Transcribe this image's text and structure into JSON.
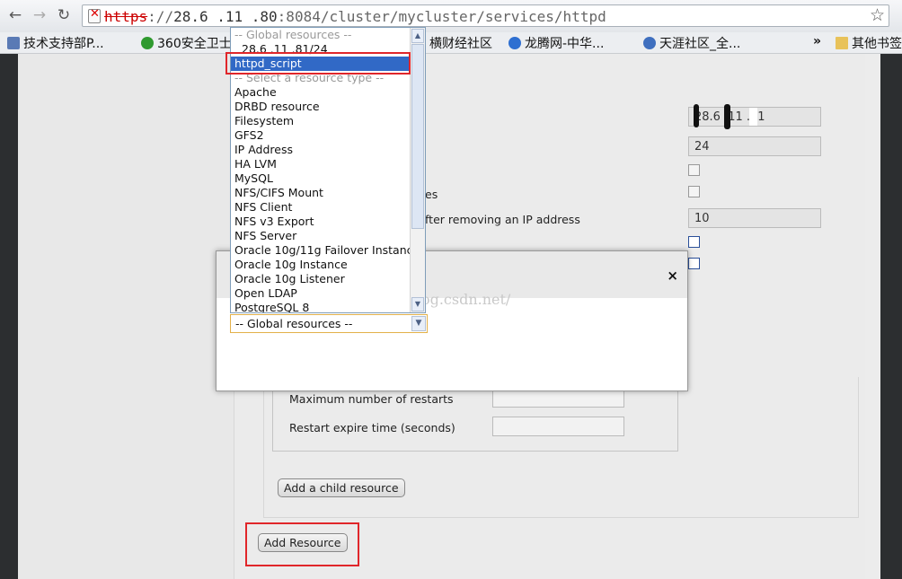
{
  "browser": {
    "nav": {
      "back": "←",
      "forward": "→",
      "reload": "↻",
      "star": "☆"
    },
    "url": {
      "scheme": "https",
      "sep": "://",
      "host": "28.6 .11 .80",
      "rest": ":8084/cluster/mycluster/services/httpd"
    },
    "bookmarks": [
      {
        "label": "技术支持部P...",
        "color": "#5a7ab5"
      },
      {
        "label": "360安全卫士",
        "color": "#2f9a2f"
      },
      {
        "label": "横财经社区",
        "color": "#c04a2a"
      },
      {
        "label": "龙腾网-中华...",
        "color": "#2e6fd1"
      },
      {
        "label": "天涯社区_全...",
        "color": "#3f6fbf"
      }
    ],
    "more": "»",
    "other_bookmarks": "其他书签"
  },
  "form": {
    "ip_value": "28.6 .11 .81",
    "netmask_value": "24",
    "label_es": "es",
    "label_after_remove": "fter removing an IP address",
    "sleep_value": "10",
    "max_restarts_label": "Maximum number of restarts",
    "restart_expire_label": "Restart expire time (seconds)",
    "add_child_button": "Add a child resource",
    "add_resource_button": "Add Resource"
  },
  "modal": {
    "close": "×",
    "watermark": "http://blog.csdn.net/"
  },
  "dropdown": {
    "options": [
      {
        "label": "-- Global resources --",
        "kind": "group"
      },
      {
        "label": "28.6 .11 .81/24",
        "kind": "item"
      },
      {
        "label": "httpd_script",
        "kind": "selected"
      },
      {
        "label": "-- Select a resource type --",
        "kind": "group"
      },
      {
        "label": "Apache",
        "kind": "item"
      },
      {
        "label": "DRBD resource",
        "kind": "item"
      },
      {
        "label": "Filesystem",
        "kind": "item"
      },
      {
        "label": "GFS2",
        "kind": "item"
      },
      {
        "label": "IP Address",
        "kind": "item"
      },
      {
        "label": "HA LVM",
        "kind": "item"
      },
      {
        "label": "MySQL",
        "kind": "item"
      },
      {
        "label": "NFS/CIFS Mount",
        "kind": "item"
      },
      {
        "label": "NFS Client",
        "kind": "item"
      },
      {
        "label": "NFS v3 Export",
        "kind": "item"
      },
      {
        "label": "NFS Server",
        "kind": "item"
      },
      {
        "label": "Oracle 10g/11g Failover Instance",
        "kind": "item"
      },
      {
        "label": "Oracle 10g Instance",
        "kind": "item"
      },
      {
        "label": "Oracle 10g Listener",
        "kind": "item"
      },
      {
        "label": "Open LDAP",
        "kind": "item"
      },
      {
        "label": "PostgreSQL 8",
        "kind": "item"
      }
    ],
    "selected_value": "-- Global resources --",
    "scroll_up": "▲",
    "scroll_down": "▼",
    "combo_arrow": "▼"
  }
}
